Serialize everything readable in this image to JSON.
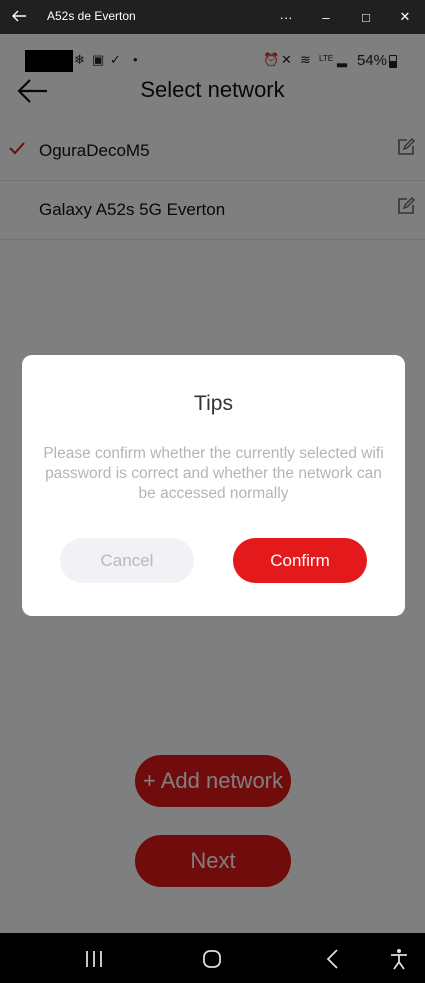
{
  "window": {
    "title": "A52s de Everton",
    "minimize": "–",
    "maximize": "□",
    "close": "✕",
    "more": "···"
  },
  "status": {
    "battery": "54%"
  },
  "page": {
    "title": "Select network"
  },
  "networks": [
    {
      "name": "OguraDecoM5",
      "selected": true
    },
    {
      "name": "Galaxy A52s 5G Everton",
      "selected": false
    }
  ],
  "buttons": {
    "add_network": "+ Add network",
    "next": "Next"
  },
  "dialog": {
    "title": "Tips",
    "message": "Please confirm whether the currently selected wifi password is correct and whether the network can be accessed normally",
    "cancel": "Cancel",
    "confirm": "Confirm"
  },
  "colors": {
    "accent": "#e3191b"
  }
}
